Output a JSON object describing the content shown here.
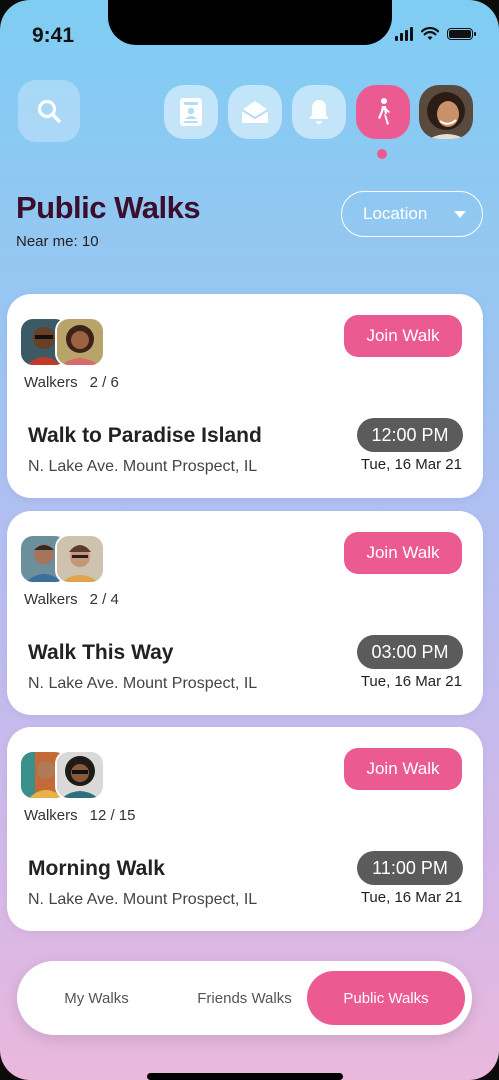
{
  "status_bar": {
    "time": "9:41"
  },
  "top_nav": {
    "icons": [
      "search-icon",
      "contacts-icon",
      "mail-icon",
      "bell-icon",
      "walking-person-icon",
      "avatar"
    ],
    "active": "walking-person-icon",
    "accent": "#ec5a92"
  },
  "header": {
    "title": "Public Walks",
    "near_me": "Near me: 10",
    "location_label": "Location"
  },
  "walks": [
    {
      "walkers_label": "Walkers",
      "walkers_count": "2 / 6",
      "join_label": "Join Walk",
      "title": "Walk to Paradise Island",
      "address": "N. Lake Ave. Mount Prospect, IL",
      "time": "12:00 PM",
      "date": "Tue, 16 Mar 21"
    },
    {
      "walkers_label": "Walkers",
      "walkers_count": "2 / 4",
      "join_label": "Join Walk",
      "title": "Walk This Way",
      "address": "N. Lake Ave. Mount Prospect, IL",
      "time": "03:00 PM",
      "date": "Tue, 16 Mar 21"
    },
    {
      "walkers_label": "Walkers",
      "walkers_count": "12 / 15",
      "join_label": "Join Walk",
      "title": "Morning Walk",
      "address": "N. Lake Ave. Mount Prospect, IL",
      "time": "11:00 PM",
      "date": "Tue, 16 Mar 21"
    }
  ],
  "tabs": [
    {
      "label": "My Walks"
    },
    {
      "label": "Friends Walks"
    },
    {
      "label": "Public Walks"
    }
  ],
  "active_tab": "Public Walks"
}
